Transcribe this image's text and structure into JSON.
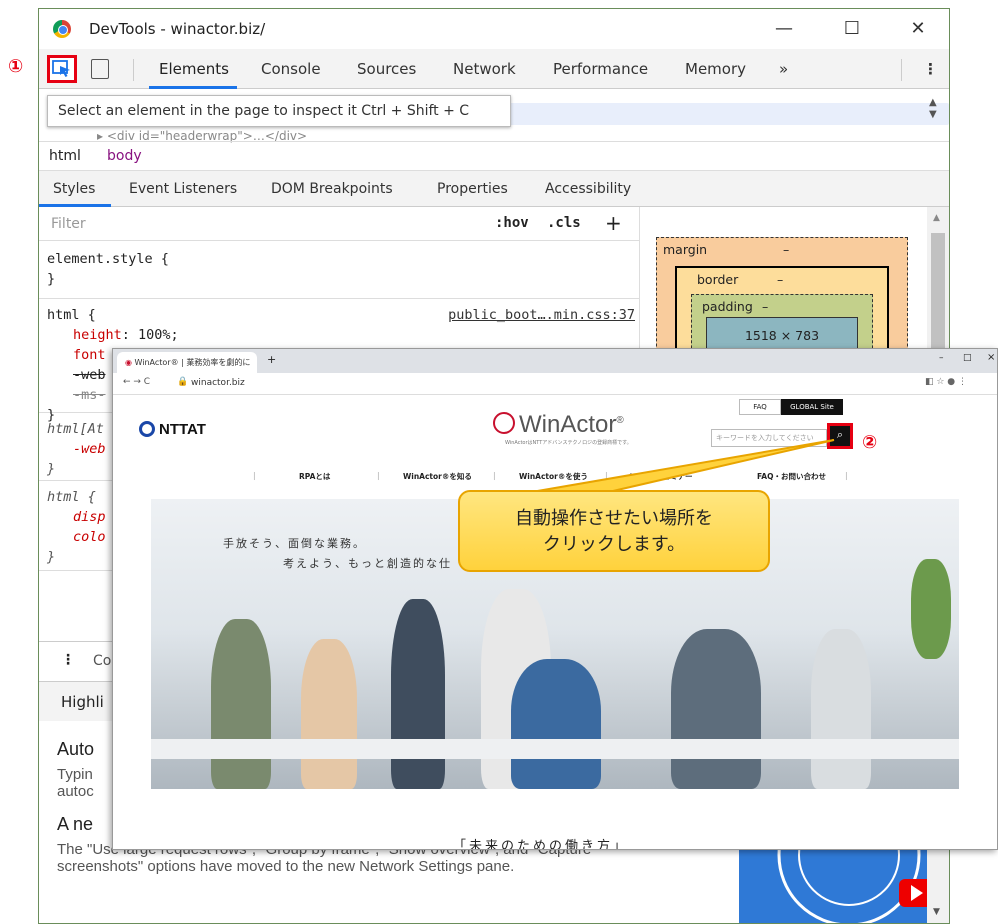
{
  "devtools": {
    "window_title": "DevTools - winactor.biz/",
    "tabs": [
      "Elements",
      "Console",
      "Sources",
      "Network",
      "Performance",
      "Memory"
    ],
    "more_tabs": "»",
    "tooltip": "Select an element in the page to inspect it  Ctrl + Shift + C",
    "breadcrumbs": [
      "html",
      "body"
    ],
    "subtabs": [
      "Styles",
      "Event Listeners",
      "DOM Breakpoints",
      "Properties",
      "Accessibility"
    ],
    "filter_placeholder": "Filter",
    "hov": ":hov",
    "cls": ".cls",
    "plus": "+",
    "styles": {
      "element_style": "element.style {",
      "close": "}",
      "html_rule": "html {",
      "html_src": "public_boot….min.css:37",
      "height_prop": "height",
      "height_val": ": 100%;",
      "font_prop": "font",
      "webkit_prop": "-web",
      "ms_prop": "-ms-",
      "attr_rule": "html[At",
      "attr_prop": "-web",
      "html2_rule": "html {",
      "disp_prop": "disp",
      "color_prop": "colo"
    },
    "boxmodel": {
      "margin": "margin",
      "border": "border",
      "padding": "padding",
      "dash": "–",
      "content": "1518 × 783"
    },
    "console_label": "Co",
    "highlights_label": "Highli",
    "whatsnew": {
      "h1": "Auto",
      "p1a": "Typin",
      "p1b": "autoc",
      "h2": "A ne",
      "p2": "The \"Use large request rows\", \"Group by frame\", \"Show overview\", and \"Capture screenshots\" options have moved to the new Network Settings pane."
    }
  },
  "browser": {
    "tab_title": "WinActor® | 業務効率を劇的に力",
    "tab_close": "×",
    "new_tab": "+",
    "url": "winactor.biz",
    "win_min": "–",
    "win_max": "□",
    "win_close": "×"
  },
  "site": {
    "ntt": "NTTAT",
    "winactor": "WinActor",
    "winactor_reg": "®",
    "tagline": "WinActorはNTTアドバンステクノロジの登録商標です。",
    "faq": "FAQ",
    "global": "GLOBAL Site",
    "search_placeholder": "キーワードを入力してください",
    "search_icon": "⌕",
    "nav": [
      "RPAとは",
      "WinActor®を知る",
      "WinActor®を使う",
      "イベント・セミナー",
      "FAQ・お問い合わせ"
    ],
    "hero_line1": "手放そう、面倒な業務。",
    "hero_line2": "考えよう、もっと創造的な仕",
    "bottom": "「未来のための働き方」"
  },
  "annotations": {
    "step1": "①",
    "step2": "②",
    "callout_line1": "自動操作させたい場所を",
    "callout_line2": "クリックします。",
    "accent_red": "#e60012",
    "callout_yellow": "#ffd23c"
  }
}
